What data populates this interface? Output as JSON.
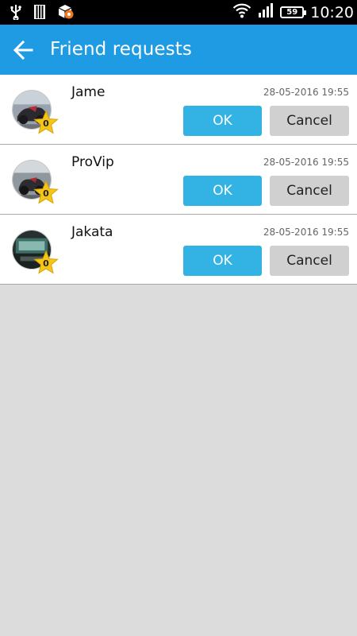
{
  "status_bar": {
    "time": "10:20",
    "battery": "59",
    "icons": [
      "usb-icon",
      "sd-card-icon",
      "app-notification-icon",
      "wifi-icon",
      "signal-icon",
      "battery-icon"
    ]
  },
  "app_bar": {
    "title": "Friend requests",
    "back_icon": "arrow-left-icon",
    "color": "#1e9be3"
  },
  "requests": [
    {
      "name": "Jame",
      "date": "28-05-2016 19:55",
      "level": "0",
      "ok_label": "OK",
      "cancel_label": "Cancel"
    },
    {
      "name": "ProVip",
      "date": "28-05-2016 19:55",
      "level": "0",
      "ok_label": "OK",
      "cancel_label": "Cancel"
    },
    {
      "name": "Jakata",
      "date": "28-05-2016 19:55",
      "level": "0",
      "ok_label": "OK",
      "cancel_label": "Cancel"
    }
  ],
  "colors": {
    "ok_button": "#33b2e4",
    "cancel_button": "#d0d0d0",
    "background": "#dcdcdc",
    "star": "#f5c518"
  }
}
